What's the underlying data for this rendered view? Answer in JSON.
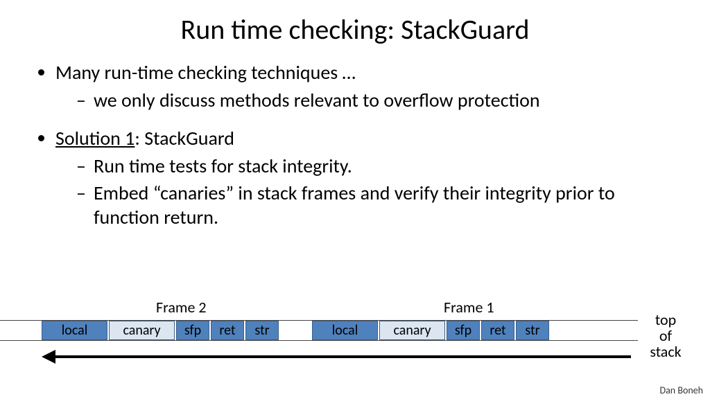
{
  "title": "Run time checking: StackGuard",
  "bullets": {
    "b1": "Many run-time checking techniques …",
    "b1a": "we only discuss methods relevant to overflow protection",
    "b2_prefix": "Solution 1",
    "b2_suffix": ":  StackGuard",
    "b2a": "Run time tests for stack integrity.",
    "b2b": "Embed “canaries” in stack frames and verify their integrity prior to function return."
  },
  "diagram": {
    "frame2_label": "Frame 2",
    "frame1_label": "Frame 1",
    "top_label": "top\nof\nstack",
    "segments": {
      "local": "local",
      "canary": "canary",
      "sfp": "sfp",
      "ret": "ret",
      "str": "str"
    }
  },
  "author": "Dan Boneh"
}
